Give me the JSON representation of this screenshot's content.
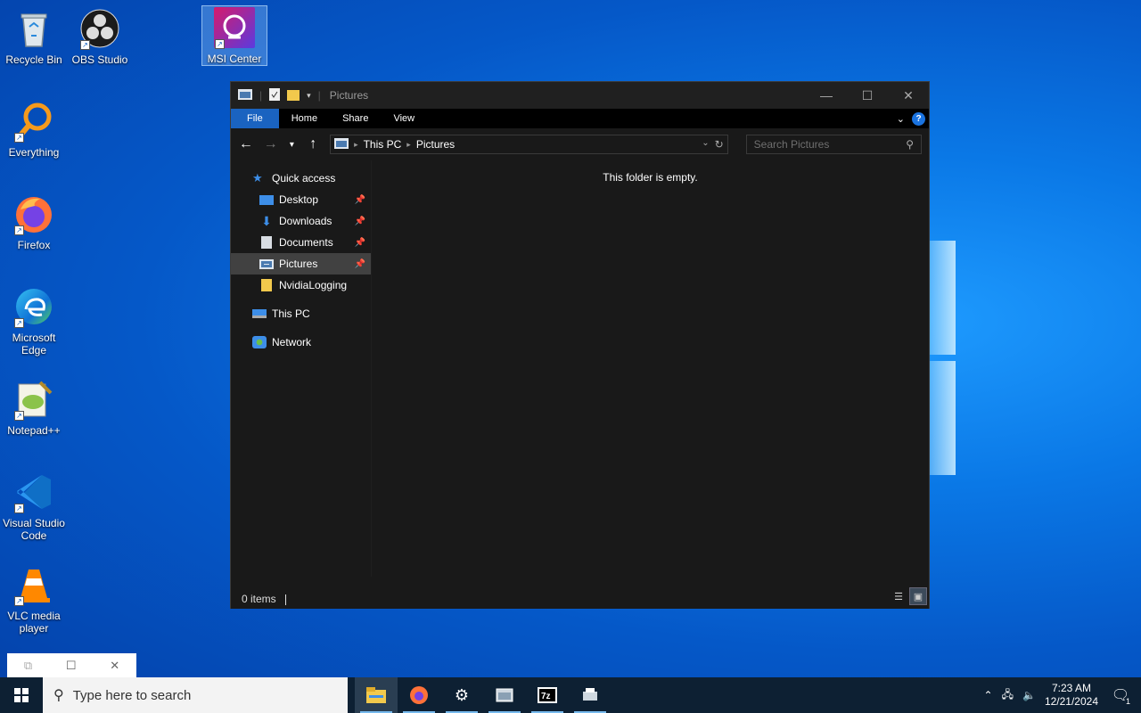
{
  "desktop": {
    "icons": [
      {
        "label": "Recycle Bin"
      },
      {
        "label": "OBS Studio"
      },
      {
        "label": "MSI Center"
      },
      {
        "label": "Everything"
      },
      {
        "label": "Firefox"
      },
      {
        "label": "Microsoft Edge"
      },
      {
        "label": "Notepad++"
      },
      {
        "label": "Visual Studio Code"
      },
      {
        "label": "VLC media player"
      }
    ]
  },
  "explorer": {
    "title": "Pictures",
    "ribbon_tabs": [
      "File",
      "Home",
      "Share",
      "View"
    ],
    "help_label": "?",
    "address": [
      "This PC",
      "Pictures"
    ],
    "search_placeholder": "Search Pictures",
    "sidebar": {
      "quick_access": "Quick access",
      "items": [
        "Desktop",
        "Downloads",
        "Documents",
        "Pictures",
        "NvidiaLogging"
      ],
      "this_pc": "This PC",
      "network": "Network"
    },
    "empty_message": "This folder is empty.",
    "status": "0 items"
  },
  "taskbar": {
    "search_placeholder": "Type here to search",
    "time": "7:23 AM",
    "date": "12/21/2024",
    "notification_count": "1"
  },
  "colors": {
    "accent": "#1a63c0",
    "dark_bg": "#191919",
    "taskbar": "#0d2033"
  }
}
